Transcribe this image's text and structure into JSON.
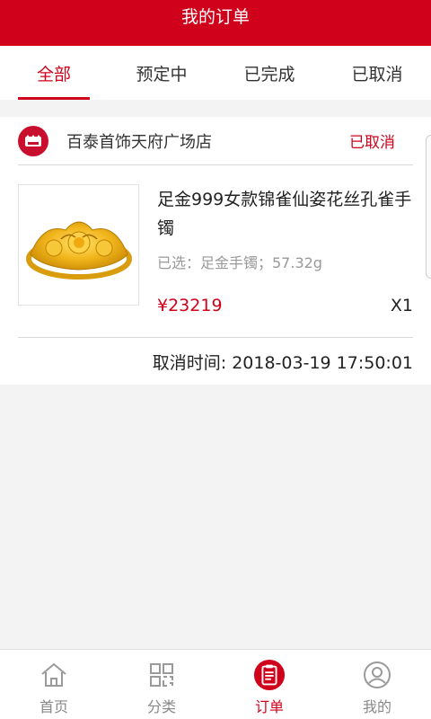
{
  "header": {
    "title": "我的订单"
  },
  "tabs": [
    {
      "label": "全部",
      "active": true
    },
    {
      "label": "预定中",
      "active": false
    },
    {
      "label": "已完成",
      "active": false
    },
    {
      "label": "已取消",
      "active": false
    }
  ],
  "order": {
    "shop_name": "百泰首饰天府广场店",
    "status": "已取消",
    "product": {
      "title": "足金999女款锦雀仙姿花丝孔雀手镯",
      "spec": "已选：足金手镯；57.32g",
      "price": "¥23219",
      "quantity": "X1"
    },
    "cancel_time": "取消时间: 2018-03-19 17:50:01"
  },
  "bottom_nav": [
    {
      "label": "首页",
      "icon": "home-icon",
      "active": false
    },
    {
      "label": "分类",
      "icon": "category-icon",
      "active": false
    },
    {
      "label": "订单",
      "icon": "order-icon",
      "active": true
    },
    {
      "label": "我的",
      "icon": "profile-icon",
      "active": false
    }
  ],
  "colors": {
    "brand": "#d0021b",
    "muted": "#999999"
  }
}
